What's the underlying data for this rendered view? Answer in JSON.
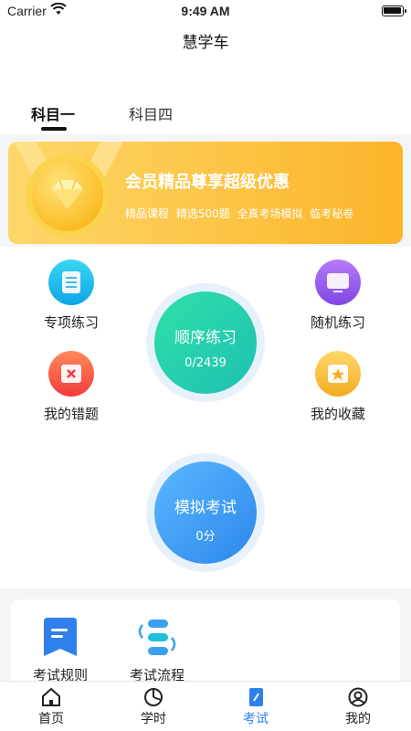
{
  "status_bar": {
    "carrier": "Carrier",
    "time": "9:49 AM"
  },
  "nav": {
    "title": "慧学车"
  },
  "subject_tabs": [
    {
      "label": "科目一",
      "active": true
    },
    {
      "label": "科目四",
      "active": false
    }
  ],
  "banner": {
    "headline": "会员精品尊享超级优惠",
    "features": "精品课程 精选500题 全真考场模拟 临考秘卷"
  },
  "practice": {
    "special": {
      "label": "专项练习",
      "icon": "document-icon"
    },
    "random": {
      "label": "随机练习",
      "icon": "monitor-icon"
    },
    "mistakes": {
      "label": "我的错题",
      "icon": "mistake-box-icon"
    },
    "favorites": {
      "label": "我的收藏",
      "icon": "star-folder-icon"
    },
    "sequential": {
      "label": "顺序练习",
      "progress": "0/2439"
    },
    "mock_exam": {
      "label": "模拟考试",
      "score": "0分"
    }
  },
  "exam_info": {
    "rules": {
      "label": "考试规则",
      "icon": "rules-doc-icon"
    },
    "process": {
      "label": "考试流程",
      "icon": "flow-icon"
    }
  },
  "tabbar": [
    {
      "label": "首页",
      "icon": "home-icon",
      "active": false
    },
    {
      "label": "学时",
      "icon": "pie-clock-icon",
      "active": false
    },
    {
      "label": "考试",
      "icon": "exam-book-icon",
      "active": true
    },
    {
      "label": "我的",
      "icon": "user-icon",
      "active": false
    }
  ],
  "colors": {
    "accent": "#2f80ed",
    "banner": "#fcc445",
    "sequential": "#1ec0b4",
    "mock": "#2b87ea"
  }
}
